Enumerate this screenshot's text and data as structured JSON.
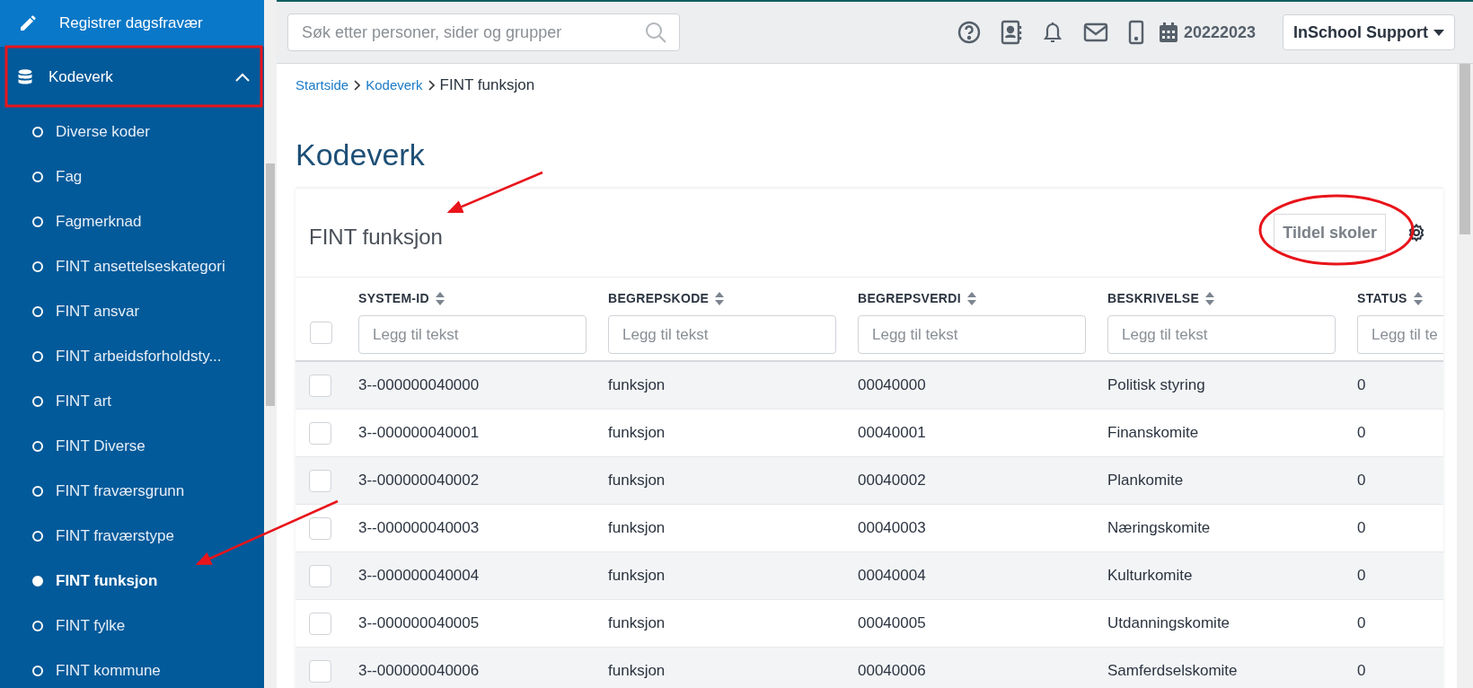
{
  "sidebar": {
    "items": [
      {
        "label": "Registrer dagsfravær",
        "kind": "link",
        "selected": false
      },
      {
        "label": "Kodeverk",
        "kind": "group",
        "selected": false,
        "expanded": true,
        "children": [
          {
            "label": "Diverse koder",
            "selected": false
          },
          {
            "label": "Fag",
            "selected": false
          },
          {
            "label": "Fagmerknad",
            "selected": false
          },
          {
            "label": "FINT ansettelseskategori",
            "selected": false
          },
          {
            "label": "FINT ansvar",
            "selected": false
          },
          {
            "label": "FINT arbeidsforholdsty...",
            "selected": false
          },
          {
            "label": "FINT art",
            "selected": false
          },
          {
            "label": "FINT Diverse",
            "selected": false
          },
          {
            "label": "FINT fraværsgrunn",
            "selected": false
          },
          {
            "label": "FINT fraværstype",
            "selected": false
          },
          {
            "label": "FINT funksjon",
            "selected": true
          },
          {
            "label": "FINT fylke",
            "selected": false
          },
          {
            "label": "FINT kommune",
            "selected": false
          }
        ]
      }
    ]
  },
  "topbar": {
    "search": {
      "placeholder": "Søk etter personer, sider og grupper"
    },
    "school_year": "20222023",
    "user_menu": "InSchool Support"
  },
  "breadcrumb": [
    {
      "label": "Startside",
      "link": true
    },
    {
      "label": "Kodeverk",
      "link": true
    },
    {
      "label": "FINT funksjon",
      "link": false
    }
  ],
  "page_title": "Kodeverk",
  "card": {
    "title": "FINT funksjon",
    "button": "Tildel skoler"
  },
  "table": {
    "select_all_checked": false,
    "columns": [
      {
        "label": "SYSTEM-ID",
        "filter_placeholder": "Legg til tekst"
      },
      {
        "label": "BEGREPSKODE",
        "filter_placeholder": "Legg til tekst"
      },
      {
        "label": "BEGREPSVERDI",
        "filter_placeholder": "Legg til tekst"
      },
      {
        "label": "BESKRIVELSE",
        "filter_placeholder": "Legg til tekst"
      },
      {
        "label": "STATUS",
        "filter_placeholder": "Legg til te"
      }
    ],
    "rows": [
      {
        "checked": false,
        "cells": [
          "3--000000040000",
          "funksjon",
          "00040000",
          "Politisk styring",
          "0"
        ]
      },
      {
        "checked": false,
        "cells": [
          "3--000000040001",
          "funksjon",
          "00040001",
          "Finanskomite",
          "0"
        ]
      },
      {
        "checked": false,
        "cells": [
          "3--000000040002",
          "funksjon",
          "00040002",
          "Plankomite",
          "0"
        ]
      },
      {
        "checked": false,
        "cells": [
          "3--000000040003",
          "funksjon",
          "00040003",
          "Næringskomite",
          "0"
        ]
      },
      {
        "checked": false,
        "cells": [
          "3--000000040004",
          "funksjon",
          "00040004",
          "Kulturkomite",
          "0"
        ]
      },
      {
        "checked": false,
        "cells": [
          "3--000000040005",
          "funksjon",
          "00040005",
          "Utdanningskomite",
          "0"
        ]
      },
      {
        "checked": false,
        "cells": [
          "3--000000040006",
          "funksjon",
          "00040006",
          "Samferdselskomite",
          "0"
        ]
      }
    ]
  }
}
